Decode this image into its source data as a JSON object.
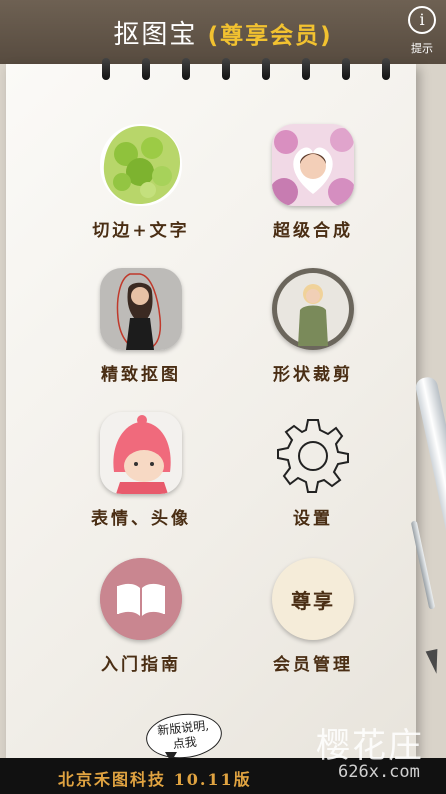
{
  "header": {
    "app_name": "抠图宝",
    "vip_label": "(尊享会员)",
    "hint_icon": "i",
    "hint_label": "提示"
  },
  "menu": [
    {
      "id": "cut-edge-text",
      "label": "切边+文字",
      "icon": "green-leaves-image"
    },
    {
      "id": "super-compose",
      "label": "超级合成",
      "icon": "flower-portrait-image"
    },
    {
      "id": "precise-cutout",
      "label": "精致抠图",
      "icon": "woman-outline-image"
    },
    {
      "id": "shape-crop",
      "label": "形状裁剪",
      "icon": "circle-portrait-image"
    },
    {
      "id": "emoji-avatar",
      "label": "表情、头像",
      "icon": "cartoon-girl-image"
    },
    {
      "id": "settings",
      "label": "设置",
      "icon": "gear-icon"
    },
    {
      "id": "guide",
      "label": "入门指南",
      "icon": "book-icon"
    },
    {
      "id": "vip-manage",
      "label": "会员管理",
      "icon": "vip-badge",
      "badge_text": "尊享"
    }
  ],
  "bubble": {
    "line1": "新版说明,",
    "line2": "点我"
  },
  "footer": {
    "text": "北京禾图科技   10.11版"
  },
  "watermark": {
    "cn": "樱花庄",
    "url": "626x.com"
  },
  "colors": {
    "header": "#5f5347",
    "accent": "#f2c230",
    "label": "#4a2e14",
    "footer_text": "#e0a341"
  }
}
